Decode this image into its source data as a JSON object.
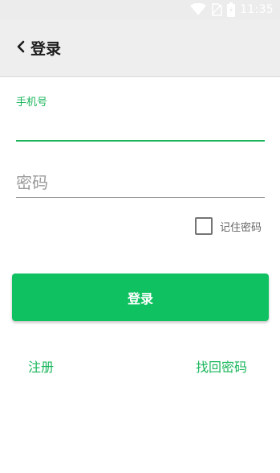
{
  "status_bar": {
    "time": "11:35",
    "icons": [
      "wifi-icon",
      "no-sim-icon",
      "battery-icon"
    ]
  },
  "app_bar": {
    "back_icon": "chevron-left-icon",
    "title": "登录"
  },
  "form": {
    "phone_label": "手机号",
    "phone_value": "",
    "password_placeholder": "密码",
    "password_value": "",
    "remember_label": "记住密码",
    "remember_checked": false
  },
  "actions": {
    "login_label": "登录",
    "register_label": "注册",
    "forgot_label": "找回密码"
  },
  "colors": {
    "accent": "#0fc160",
    "link": "#19b65b",
    "app_bar_bg": "#eeeeee"
  }
}
